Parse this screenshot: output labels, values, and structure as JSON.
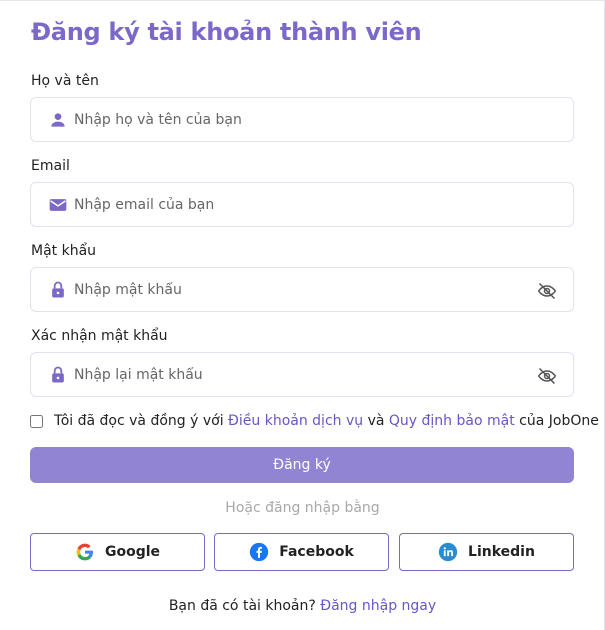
{
  "title": "Đăng ký tài khoản thành viên",
  "fields": {
    "name": {
      "label": "Họ và tên",
      "placeholder": "Nhập họ và tên của bạn",
      "icon": "user-icon"
    },
    "email": {
      "label": "Email",
      "placeholder": "Nhập email của bạn",
      "icon": "mail-icon"
    },
    "password": {
      "label": "Mật khẩu",
      "placeholder": "Nhập mật khẩu",
      "icon": "lock-icon"
    },
    "confirm": {
      "label": "Xác nhận mật khẩu",
      "placeholder": "Nhập lại mật khẩu",
      "icon": "lock-icon"
    }
  },
  "agreement": {
    "prefix": "Tôi đã đọc và đồng ý với",
    "terms_link": "Điều khoản dịch vụ",
    "and": "và",
    "privacy_link": "Quy định bảo mật",
    "suffix": "của JobOne",
    "checked": false
  },
  "submit_label": "Đăng ký",
  "or_text": "Hoặc đăng nhập bằng",
  "social": {
    "google": "Google",
    "facebook": "Facebook",
    "linkedin": "Linkedin"
  },
  "login": {
    "prompt": "Bạn đã có tài khoản?",
    "link": "Đăng nhập ngay"
  },
  "colors": {
    "accent": "#7b68c8",
    "button": "#9084d3",
    "link": "#6a55c6"
  }
}
